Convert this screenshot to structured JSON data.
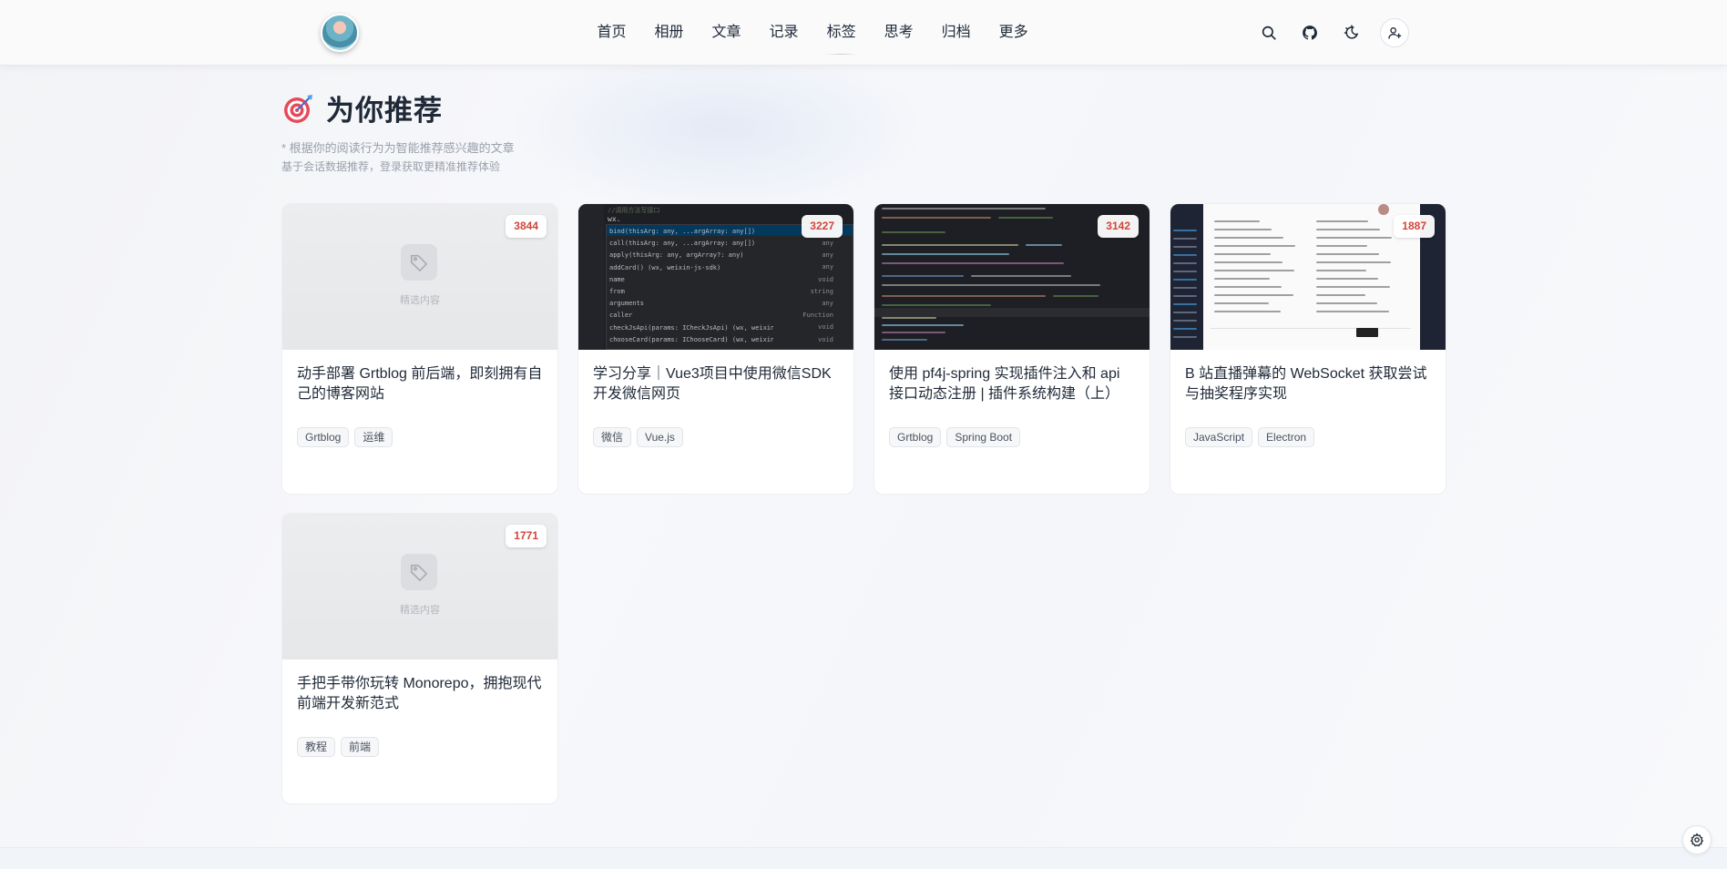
{
  "nav": {
    "items": [
      "首页",
      "相册",
      "文章",
      "记录",
      "标签",
      "思考",
      "归档",
      "更多"
    ]
  },
  "header_icons": [
    "search-icon",
    "github-icon",
    "theme-toggle-icon",
    "user-add-icon"
  ],
  "page": {
    "title": "为你推荐",
    "subtitle": "* 根据你的阅读行为为智能推荐感兴趣的文章",
    "subtitle2": "基于会话数据推荐，登录获取更精准推荐体验"
  },
  "placeholder_label": "精选内容",
  "cards": [
    {
      "title": "动手部署 Grtblog 前后端，即刻拥有自己的博客网站",
      "count": "3844",
      "tags": [
        "Grtblog",
        "运维"
      ],
      "thumb": "placeholder"
    },
    {
      "title": "学习分享｜Vue3项目中使用微信SDK开发微信网页",
      "count": "3227",
      "tags": [
        "微信",
        "Vue.js"
      ],
      "thumb": "code-autocomplete"
    },
    {
      "title": "使用 pf4j-spring 实现插件注入和 api 接口动态注册 | 插件系统构建（上）",
      "count": "3142",
      "tags": [
        "Grtblog",
        "Spring Boot"
      ],
      "thumb": "code-editor"
    },
    {
      "title": "B 站直播弹幕的 WebSocket 获取尝试与抽奖程序实现",
      "count": "1887",
      "tags": [
        "JavaScript",
        "Electron"
      ],
      "thumb": "app-window"
    },
    {
      "title": "手把手带你玩转 Monorepo，拥抱现代前端开发新范式",
      "count": "1771",
      "tags": [
        "教程",
        "前端"
      ],
      "thumb": "placeholder"
    }
  ],
  "thumb_code_text": {
    "autocomplete": [
      "//调用方法写接口",
      "wx.",
      "bind(thisArg: any, ...argArray: any[])",
      "call(thisArg: any, ...argArray: any[])",
      "apply(thisArg: any, argArray?: any)",
      "addCard() (wx, weixin-js-sdk)",
      "name",
      "from",
      "arguments",
      "caller",
      "checkJsApi(params: ICheckJsApi) (wx, weixin-js-sd",
      "chooseCard(params: IChooseCard) (wx, weixin-js-sd"
    ],
    "autocomplete_types": [
      "any",
      "any",
      "any",
      "void",
      "string",
      "",
      "any",
      "Function",
      "void",
      "void"
    ]
  },
  "colors": {
    "accent_red": "#d0463b",
    "text": "#1f2937",
    "muted": "#9aa0ab"
  }
}
